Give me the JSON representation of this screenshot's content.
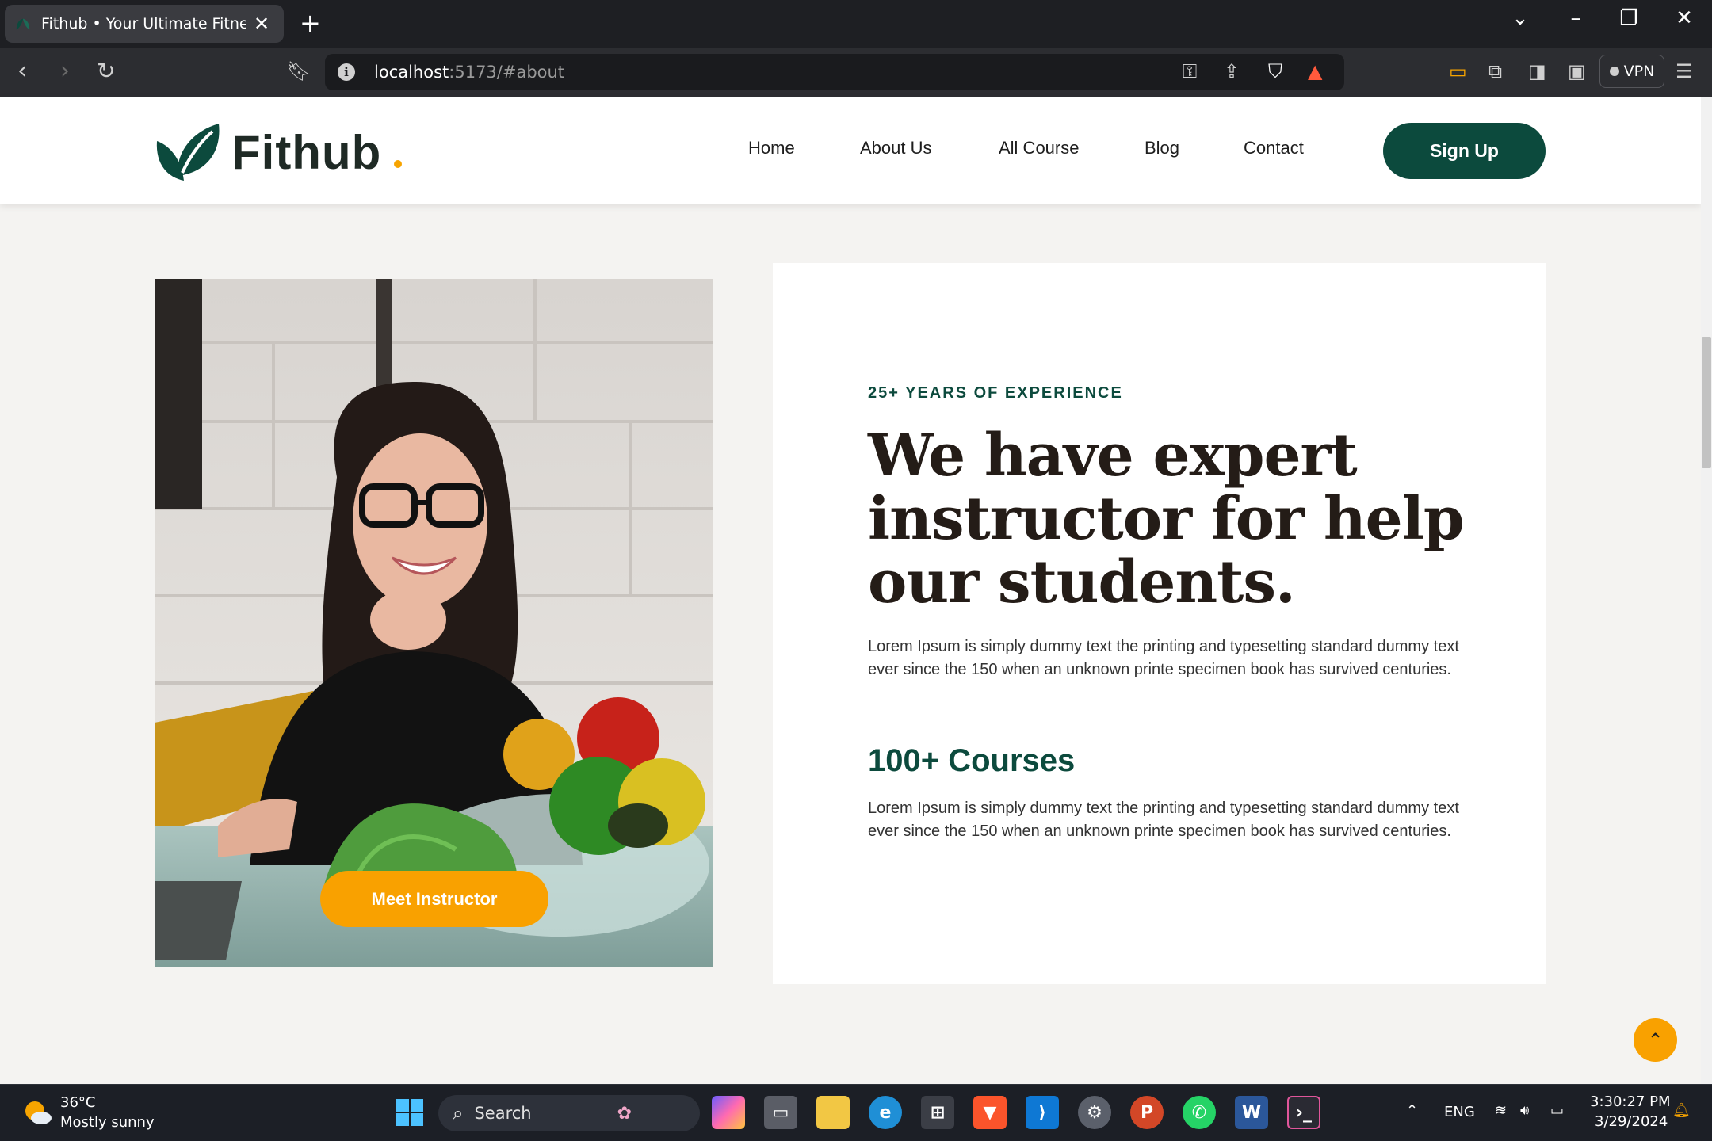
{
  "browser": {
    "tab_title": "Fithub • Your Ultimate Fitness Co",
    "url_host": "localhost",
    "url_path": ":5173/#about",
    "vpn_label": "VPN"
  },
  "site": {
    "logo_text": "Fithub",
    "nav": [
      "Home",
      "About Us",
      "All Course",
      "Blog",
      "Contact"
    ],
    "signup_label": "Sign Up",
    "brand_color": "#0c4a3d",
    "accent_color": "#f9a100"
  },
  "about": {
    "meet_button": "Meet Instructor",
    "eyebrow": "25+ YEARS OF EXPERIENCE",
    "headline": "We have expert instructor for help our students.",
    "paragraph_1": "Lorem Ipsum is simply dummy text the printing and typesetting standard dummy text ever since the 150 when an unknown printe specimen book has survived centuries.",
    "courses_heading": "100+ Courses",
    "paragraph_2": "Lorem Ipsum is simply dummy text the printing and typesetting standard dummy text ever since the 150 when an unknown printe specimen book has survived centuries."
  },
  "taskbar": {
    "weather_temp": "36°C",
    "weather_desc": "Mostly sunny",
    "search_placeholder": "Search",
    "language": "ENG",
    "time": "3:30:27 PM",
    "date": "3/29/2024"
  }
}
